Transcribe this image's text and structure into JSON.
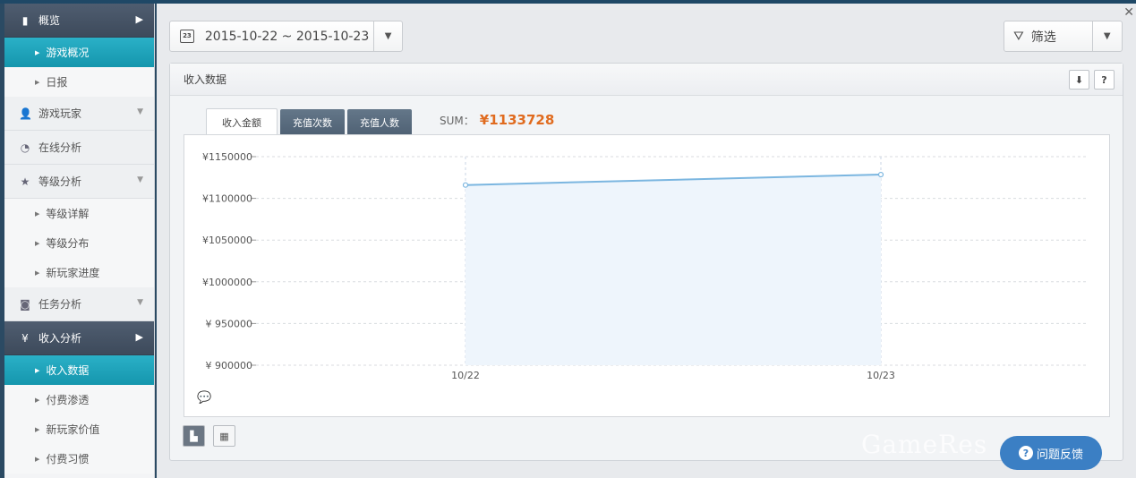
{
  "sidebar": {
    "groups": [
      {
        "label": "概览",
        "icon": "overview-icon"
      },
      {
        "label": "游戏玩家",
        "icon": "user-icon"
      },
      {
        "label": "在线分析",
        "icon": "clock-icon"
      },
      {
        "label": "等级分析",
        "icon": "level-badge-icon"
      },
      {
        "label": "任务分析",
        "icon": "gamepad-icon"
      },
      {
        "label": "收入分析",
        "icon": "yen-icon"
      }
    ],
    "items": {
      "overview": [
        "游戏概况",
        "日报"
      ],
      "level": [
        "等级详解",
        "等级分布",
        "新玩家进度"
      ],
      "revenue": [
        "收入数据",
        "付费渗透",
        "新玩家价值",
        "付费习惯"
      ]
    }
  },
  "toolbar": {
    "date_range": "2015-10-22 ~ 2015-10-23",
    "filter_label": "筛选"
  },
  "panel": {
    "title": "收入数据",
    "tabs": [
      "收入金额",
      "充值次数",
      "充值人数"
    ],
    "active_tab": 0,
    "sum_label": "SUM：",
    "sum_value": "¥1133728"
  },
  "feedback": {
    "label": "问题反馈"
  },
  "watermark": "GameRes",
  "chart_data": {
    "type": "area",
    "categories": [
      "10/22",
      "10/23"
    ],
    "values": [
      1116000,
      1128500
    ],
    "ylim": [
      900000,
      1150000
    ],
    "yticks": [
      900000,
      950000,
      1000000,
      1050000,
      1100000,
      1150000
    ],
    "ytick_labels": [
      "¥ 900000",
      "¥ 950000",
      "¥1000000",
      "¥1050000",
      "¥1100000",
      "¥1150000"
    ],
    "grid": true,
    "line_color": "#7bb6e0",
    "fill_color": "#eef5fc"
  }
}
